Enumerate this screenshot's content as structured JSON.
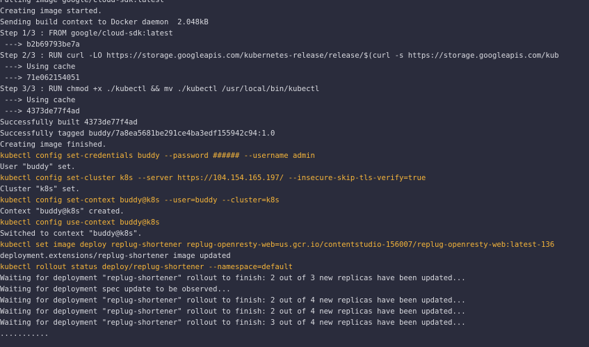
{
  "terminal": {
    "lines": [
      {
        "text": "Pulling image google/cloud-sdk:latest",
        "kind": "output"
      },
      {
        "text": "Creating image started.",
        "kind": "output"
      },
      {
        "text": "Sending build context to Docker daemon  2.048kB",
        "kind": "output"
      },
      {
        "text": "Step 1/3 : FROM google/cloud-sdk:latest",
        "kind": "output"
      },
      {
        "text": " ---> b2b69793be7a",
        "kind": "output"
      },
      {
        "text": "Step 2/3 : RUN curl -LO https://storage.googleapis.com/kubernetes-release/release/$(curl -s https://storage.googleapis.com/kub",
        "kind": "output"
      },
      {
        "text": " ---> Using cache",
        "kind": "output"
      },
      {
        "text": " ---> 71e062154051",
        "kind": "output"
      },
      {
        "text": "Step 3/3 : RUN chmod +x ./kubectl && mv ./kubectl /usr/local/bin/kubectl",
        "kind": "output"
      },
      {
        "text": " ---> Using cache",
        "kind": "output"
      },
      {
        "text": " ---> 4373de77f4ad",
        "kind": "output"
      },
      {
        "text": "Successfully built 4373de77f4ad",
        "kind": "output"
      },
      {
        "text": "Successfully tagged buddy/7a8ea5681be291ce4ba3edf155942c94:1.0",
        "kind": "output"
      },
      {
        "text": "Creating image finished.",
        "kind": "output"
      },
      {
        "text": "kubectl config set-credentials buddy --password ###### --username admin",
        "kind": "command"
      },
      {
        "text": "User \"buddy\" set.",
        "kind": "output"
      },
      {
        "text": "kubectl config set-cluster k8s --server https://104.154.165.197/ --insecure-skip-tls-verify=true",
        "kind": "command"
      },
      {
        "text": "Cluster \"k8s\" set.",
        "kind": "output"
      },
      {
        "text": "kubectl config set-context buddy@k8s --user=buddy --cluster=k8s",
        "kind": "command"
      },
      {
        "text": "Context \"buddy@k8s\" created.",
        "kind": "output"
      },
      {
        "text": "kubectl config use-context buddy@k8s",
        "kind": "command"
      },
      {
        "text": "Switched to context \"buddy@k8s\".",
        "kind": "output"
      },
      {
        "text": "kubectl set image deploy replug-shortener replug-openresty-web=us.gcr.io/contentstudio-156007/replug-openresty-web:latest-136",
        "kind": "command"
      },
      {
        "text": "deployment.extensions/replug-shortener image updated",
        "kind": "output"
      },
      {
        "text": "kubectl rollout status deploy/replug-shortener --namespace=default",
        "kind": "command"
      },
      {
        "text": "Waiting for deployment \"replug-shortener\" rollout to finish: 2 out of 3 new replicas have been updated...",
        "kind": "output"
      },
      {
        "text": "Waiting for deployment spec update to be observed...",
        "kind": "output"
      },
      {
        "text": "Waiting for deployment \"replug-shortener\" rollout to finish: 2 out of 4 new replicas have been updated...",
        "kind": "output"
      },
      {
        "text": "Waiting for deployment \"replug-shortener\" rollout to finish: 2 out of 4 new replicas have been updated...",
        "kind": "output"
      },
      {
        "text": "Waiting for deployment \"replug-shortener\" rollout to finish: 3 out of 4 new replicas have been updated...",
        "kind": "output"
      },
      {
        "text": "...........",
        "kind": "output"
      }
    ]
  },
  "colors": {
    "background": "#2a2c3c",
    "output_text": "#d7d8de",
    "command_text": "#f4b43a"
  }
}
